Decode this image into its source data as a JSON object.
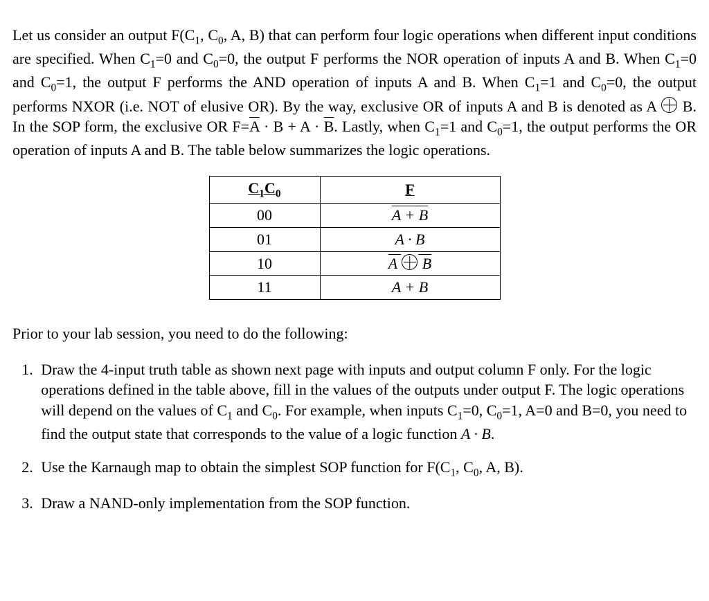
{
  "para1": {
    "seg1": "Let us consider an output F(C",
    "sub1": "1",
    "seg2": ", C",
    "sub0": "0",
    "seg3": ", A, B) that can perform four logic operations when different input conditions are specified. When C",
    "seg4": "=0 and C",
    "seg5": "=0, the output F performs the NOR operation of inputs A and B. When C",
    "seg6": "=0 and C",
    "seg7": "=1, the output F performs the AND operation of inputs A and B. When C",
    "seg8": "=1 and C",
    "seg9": "=0, the output performs NXOR (i.e. NOT of elusive OR). By the way, exclusive OR of inputs A and B is denoted as A ",
    "seg10": " B. In the SOP form, the exclusive OR F=",
    "aov": "A",
    "dot1": " · B + A · ",
    "bov": "B",
    "seg11": ". Lastly, when C",
    "seg12": "=1 and C",
    "seg13": "=1, the output performs the OR operation of inputs A and B. The table below summarizes the logic operations."
  },
  "table": {
    "header": {
      "c": "C",
      "c1": "1",
      "c0": "0",
      "f": "F"
    },
    "rows": [
      {
        "code": "00",
        "f_overline": "A + B"
      },
      {
        "code": "01",
        "f_plain": "A · B"
      },
      {
        "code": "10",
        "f_xnor_left": "A ",
        "f_xnor_right": " B"
      },
      {
        "code": "11",
        "f_plain": "A + B"
      }
    ]
  },
  "pre_tasks": "Prior to your lab session, you need to do the following:",
  "tasks": {
    "t1": {
      "seg1": "Draw the 4-input truth table as shown next page with inputs and output column F only. For the logic operations defined in the table above, fill in the values of the outputs under output F. The logic operations will depend on the values of C",
      "sub1": "1",
      "seg2": " and C",
      "sub0": "0",
      "seg3": ". For example, when inputs C",
      "seg4": "=0, C",
      "seg5": "=1, A=0 and B=0, you need to find the output state that corresponds to the value of a logic function ",
      "expr": "A · B",
      "seg6": "."
    },
    "t2": {
      "seg1": "Use the Karnaugh map to obtain the simplest SOP function for F(C",
      "sub1": "1",
      "seg2": ", C",
      "sub0": "0",
      "seg3": ", A, B)."
    },
    "t3": "Draw a NAND-only implementation from the SOP function."
  }
}
